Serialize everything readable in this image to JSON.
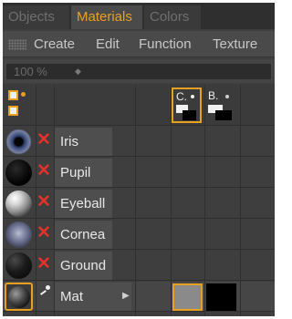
{
  "tabs": [
    {
      "label": "Objects",
      "active": false
    },
    {
      "label": "Materials",
      "active": true
    },
    {
      "label": "Colors",
      "active": false
    }
  ],
  "menu": [
    "Create",
    "Edit",
    "Function",
    "Texture"
  ],
  "zoom": {
    "value": "100 %",
    "arrow_icon": "zoom-dropdown-icon"
  },
  "layers": [
    {
      "label": "C.",
      "selected": true
    },
    {
      "label": "B.",
      "selected": false
    }
  ],
  "materials": [
    {
      "name": "Iris",
      "status_icon": "red-x-icon"
    },
    {
      "name": "Pupil",
      "status_icon": "red-x-icon"
    },
    {
      "name": "Eyeball",
      "status_icon": "red-x-icon"
    },
    {
      "name": "Cornea",
      "status_icon": "red-x-icon"
    },
    {
      "name": "Ground",
      "status_icon": "red-x-icon"
    },
    {
      "name": "Mat",
      "status_icon": "white-dot-icon",
      "has_submenu": true
    }
  ],
  "colors": {
    "accent": "#e8a020",
    "x_mark": "#e2322a",
    "background": "#3e3e3e"
  }
}
